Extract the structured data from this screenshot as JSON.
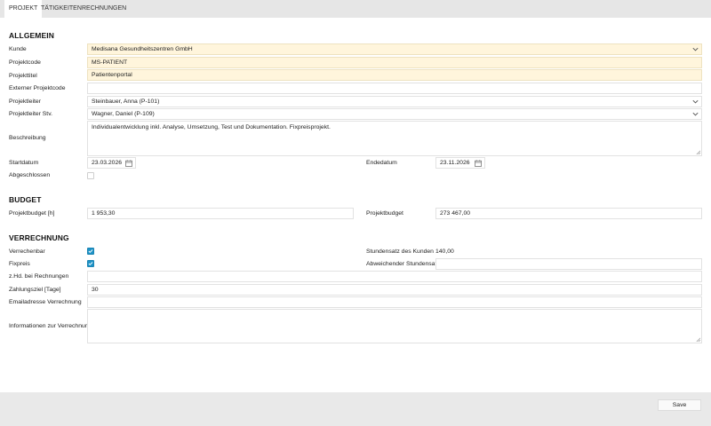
{
  "tabs": [
    {
      "label": "PROJEKT",
      "active": true
    },
    {
      "label": "TÄTIGKEITEN",
      "active": false
    },
    {
      "label": "RECHNUNGEN",
      "active": false
    }
  ],
  "sections": {
    "allgemein": "ALLGEMEIN",
    "budget": "BUDGET",
    "verrechnung": "VERRECHNUNG"
  },
  "allgemein": {
    "kunde": {
      "label": "Kunde",
      "value": "Medisana Gesundheitszentren GmbH"
    },
    "projektcode": {
      "label": "Projektcode",
      "value": "MS-PATIENT"
    },
    "projekttitel": {
      "label": "Projekttitel",
      "value": "Patientenportal"
    },
    "externer_projektcode": {
      "label": "Externer Projektcode",
      "value": ""
    },
    "projektleiter": {
      "label": "Projektleiter",
      "value": "Steinbauer, Anna (P-101)"
    },
    "projektleiter_stv": {
      "label": "Projektleiter Stv.",
      "value": "Wagner, Daniel (P-109)"
    },
    "beschreibung": {
      "label": "Beschreibung",
      "value": "Individualentwicklung inkl. Analyse, Umsetzung, Test und Dokumentation. Fixpreisprojekt."
    },
    "startdatum": {
      "label": "Startdatum",
      "value": "23.03.2026"
    },
    "endedatum": {
      "label": "Endedatum",
      "value": "23.11.2026"
    },
    "abgeschlossen": {
      "label": "Abgeschlossen",
      "checked": false
    }
  },
  "budget": {
    "projektbudget_h": {
      "label": "Projektbudget [h]",
      "value": "1 953,30"
    },
    "projektbudget": {
      "label": "Projektbudget",
      "value": "273 467,00"
    }
  },
  "verrechnung": {
    "verrechenbar": {
      "label": "Verrechenbar",
      "checked": true
    },
    "fixpreis": {
      "label": "Fixpreis",
      "checked": true
    },
    "stundensatz_kunden": {
      "label": "Stundensatz des Kunden",
      "value": "140,00"
    },
    "abweichender_stundensatz": {
      "label": "Abweichender Stundensatz",
      "value": ""
    },
    "zhd": {
      "label": "z.Hd. bei Rechnungen",
      "value": ""
    },
    "zahlungsziel": {
      "label": "Zahlungsziel [Tage]",
      "value": "30"
    },
    "emailadresse": {
      "label": "Emailadresse Verrechnung",
      "value": ""
    },
    "informationen": {
      "label": "Informationen zur Verrechnung",
      "value": ""
    }
  },
  "footer": {
    "save_label": "Save"
  },
  "icons": {
    "dropdown": "chevron-down-icon",
    "calendar": "calendar-icon",
    "checkbox_checked": "check-icon",
    "resize": "resize-grip-icon"
  },
  "colors": {
    "highlight_field": "#fff5dc",
    "checkbox_accent": "#1f93c7",
    "tabbar_bg": "#e6e6e6",
    "footer_bg": "#e9e9e9"
  }
}
